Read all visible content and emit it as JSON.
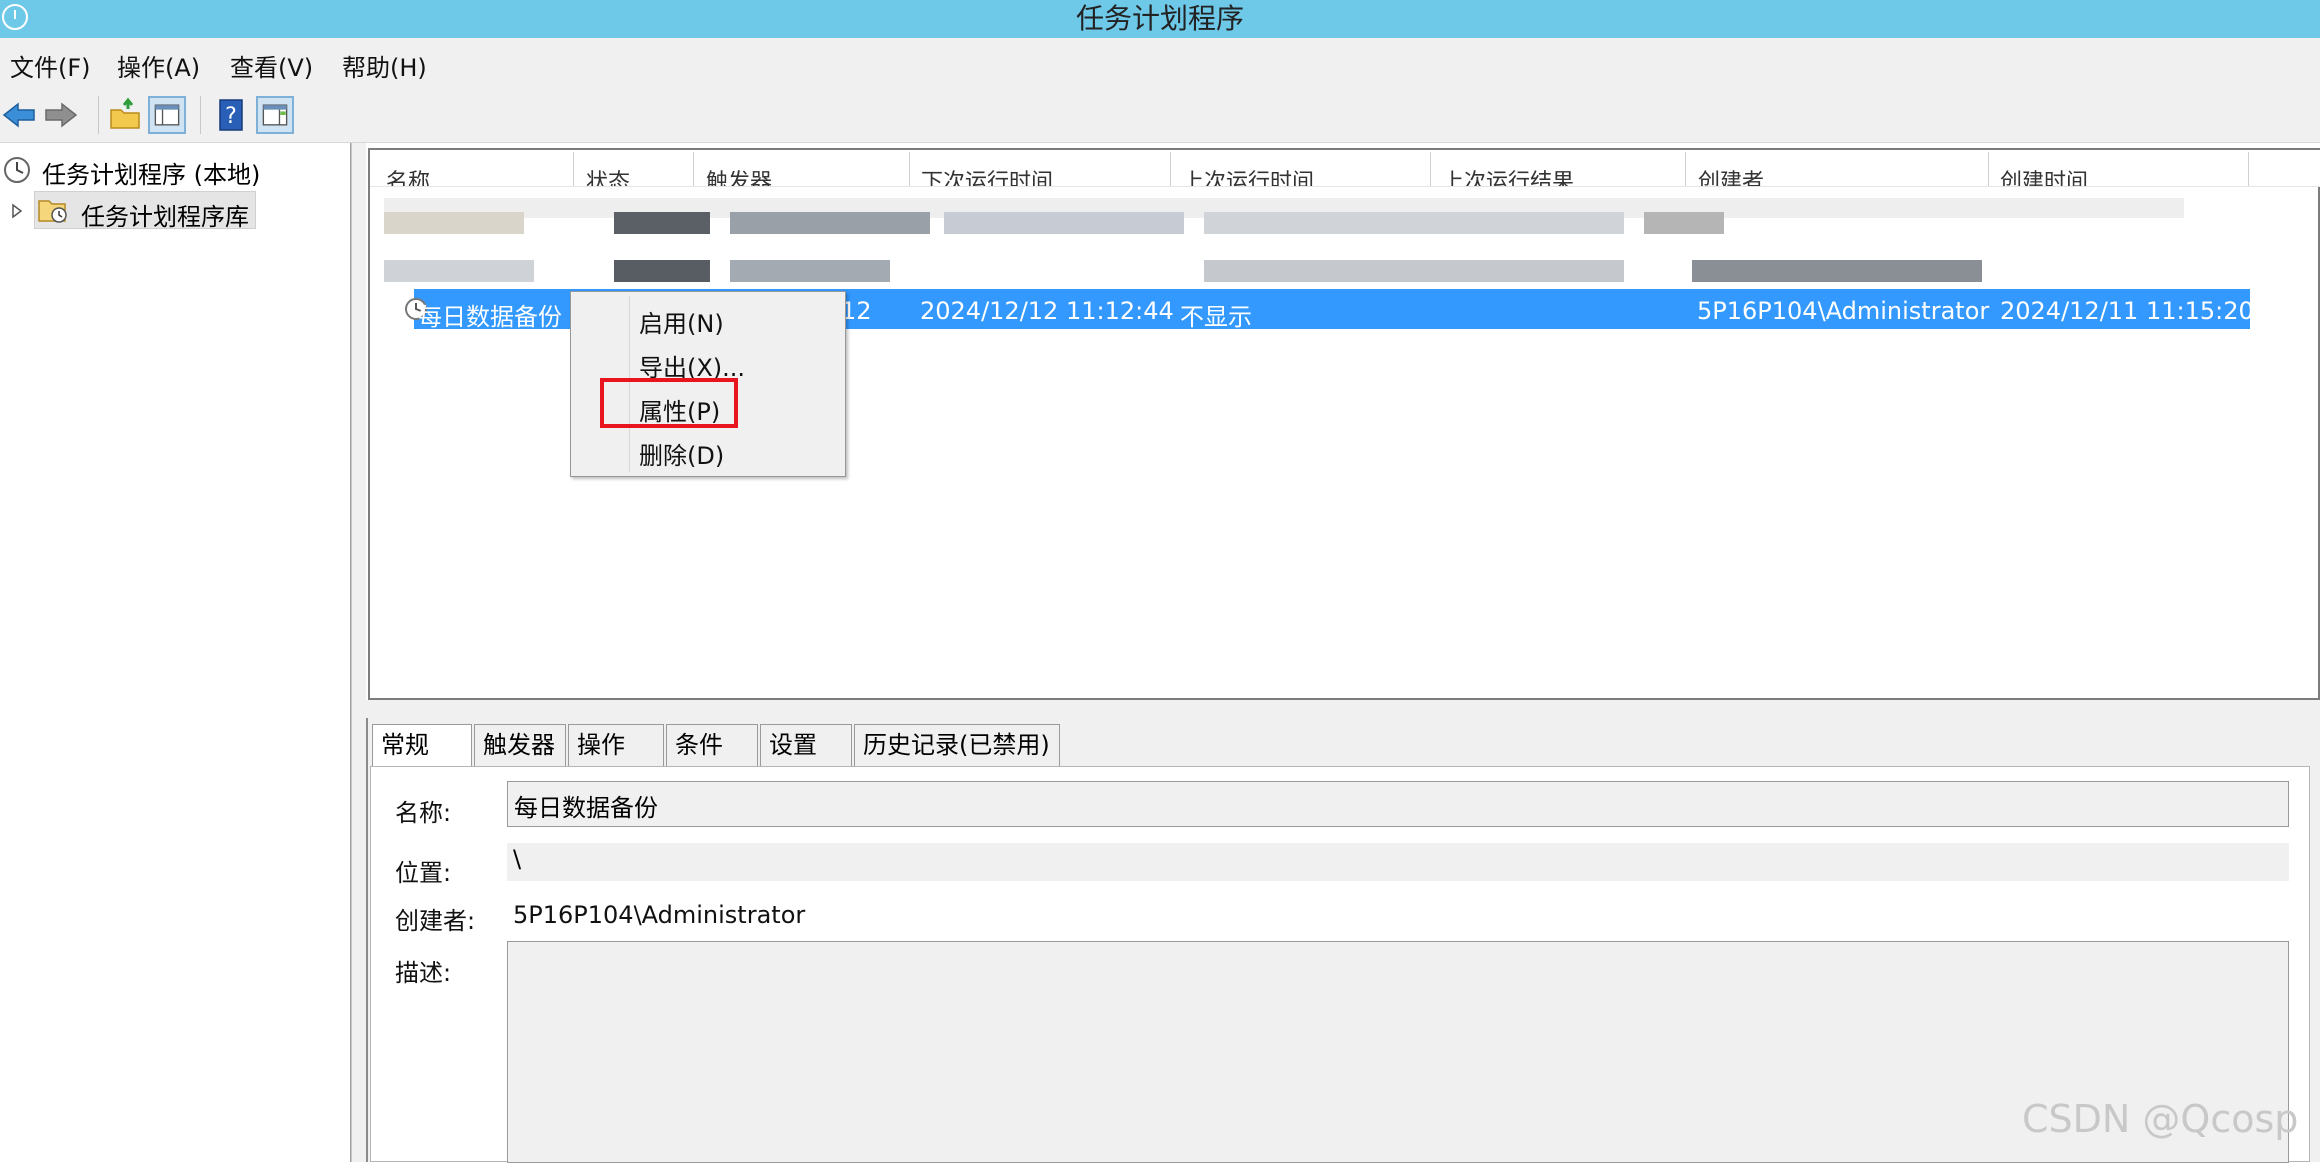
{
  "window": {
    "title": "任务计划程序"
  },
  "menu": [
    "文件(F)",
    "操作(A)",
    "查看(V)",
    "帮助(H)"
  ],
  "toolbar": {
    "icons": [
      "back-arrow-icon",
      "forward-arrow-icon",
      "folder-up-icon",
      "show-hide-console-tree-icon",
      "help-icon",
      "show-hide-action-pane-icon"
    ]
  },
  "tree": {
    "root": "任务计划程序 (本地)",
    "library": "任务计划程序库"
  },
  "list": {
    "columns": [
      "名称",
      "状态",
      "触发器",
      "下次运行时间",
      "上次运行时间",
      "上次运行结果",
      "创建者",
      "创建时间"
    ],
    "selected_row": {
      "name": "每日数据备份",
      "trigger_fragment": "12",
      "next_run": "2024/12/12 11:12:44",
      "last_result": "不显示",
      "author": "5P16P104\\Administrator",
      "created": "2024/12/11 11:15:20"
    }
  },
  "context_menu": {
    "items": [
      "启用(N)",
      "导出(X)...",
      "属性(P)",
      "删除(D)"
    ],
    "highlighted": "属性(P)",
    "highlight_color": "#e8141e"
  },
  "details": {
    "tabs": [
      "常规",
      "触发器",
      "操作",
      "条件",
      "设置",
      "历史记录(已禁用)"
    ],
    "active_tab": "常规",
    "fields": {
      "name_label": "名称:",
      "name_value": "每日数据备份",
      "location_label": "位置:",
      "location_value": "\\",
      "author_label": "创建者:",
      "author_value": "5P16P104\\Administrator",
      "description_label": "描述:"
    }
  },
  "watermark": "CSDN @Qcosp",
  "colors": {
    "titlebar": "#6ec8e8",
    "selection": "#3399ff",
    "chrome": "#f0f0f0"
  }
}
